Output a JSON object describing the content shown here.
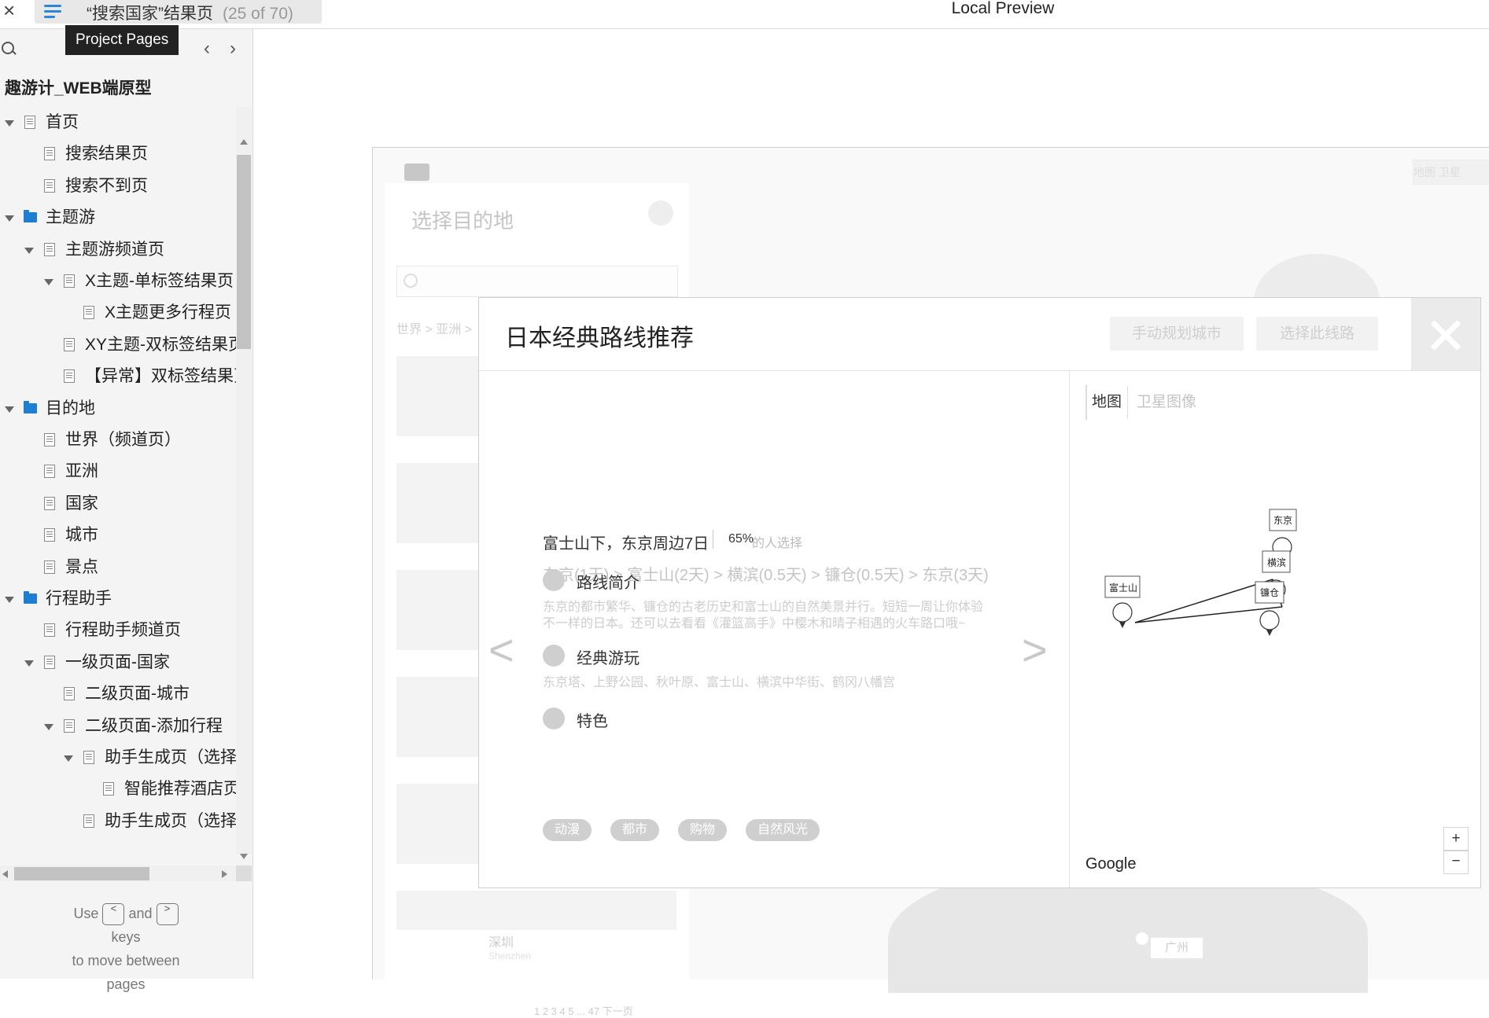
{
  "topbar": {
    "close_glyph": "×",
    "page_title": "“搜索国家”结果页",
    "page_count": "(25 of 70)",
    "preview_title": "Local Preview"
  },
  "sidebar": {
    "tooltip": "Project Pages",
    "project_name": "趣游计_WEB端原型",
    "prev_glyph": "‹",
    "next_glyph": "›",
    "items": [
      {
        "label": "首页",
        "icon": "page-icon"
      },
      {
        "label": "搜索结果页",
        "icon": "page-icon"
      },
      {
        "label": "搜索不到页",
        "icon": "page-icon"
      },
      {
        "label": "主题游",
        "icon": "folder-icon"
      },
      {
        "label": "主题游频道页",
        "icon": "page-icon"
      },
      {
        "label": "X主题-单标签结果页",
        "icon": "page-icon"
      },
      {
        "label": "X主题更多行程页",
        "icon": "page-icon"
      },
      {
        "label": "XY主题-双标签结果页",
        "icon": "page-icon"
      },
      {
        "label": "【异常】双标签结果页",
        "icon": "page-icon"
      },
      {
        "label": "目的地",
        "icon": "folder-icon"
      },
      {
        "label": "世界（频道页）",
        "icon": "page-icon"
      },
      {
        "label": "亚洲",
        "icon": "page-icon"
      },
      {
        "label": "国家",
        "icon": "page-icon"
      },
      {
        "label": "城市",
        "icon": "page-icon"
      },
      {
        "label": "景点",
        "icon": "page-icon"
      },
      {
        "label": "行程助手",
        "icon": "folder-icon"
      },
      {
        "label": "行程助手频道页",
        "icon": "page-icon"
      },
      {
        "label": "一级页面-国家",
        "icon": "page-icon"
      },
      {
        "label": "二级页面-城市",
        "icon": "page-icon"
      },
      {
        "label": "二级页面-添加行程",
        "icon": "page-icon"
      },
      {
        "label": "助手生成页（选择",
        "icon": "page-icon"
      },
      {
        "label": "智能推荐酒店页",
        "icon": "page-icon"
      },
      {
        "label": "助手生成页（选择",
        "icon": "page-icon"
      }
    ],
    "hint": {
      "use": "Use",
      "and": "and",
      "prev_key": "<",
      "next_key": ">",
      "keys": "keys",
      "line2": "to move between",
      "line3": "pages"
    }
  },
  "background_page": {
    "destination_placeholder": "选择目的地",
    "breadcrumb": "世界 > 亚洲 >",
    "list_city": "深圳",
    "list_city_en": "Shenzhen",
    "pager": "1  2  3  4  5  ...  47   下一页",
    "map_type": "地图  卫星",
    "map_city_label": "广州"
  },
  "modal": {
    "title": "日本经典路线推荐",
    "custom_button": "手动规划城市",
    "select_button": "选择此线路",
    "route": {
      "name": "富士山下，东京周边7日",
      "percent": "65%",
      "percent_label": "的人选择",
      "path": "东京(1天) > 富士山(2天) > 横滨(0.5天) > 镰仓(0.5天) > 东京(3天)"
    },
    "sections": [
      {
        "title": "路线简介",
        "body": [
          "东京的都市繁华、镰仓的古老历史和富士山的自然美景并行。短短一周让你体验",
          "不一样的日本。还可以去看看《灌篮高手》中樱木和晴子相遇的火车路口哦~"
        ]
      },
      {
        "title": "经典游玩",
        "body": [
          "东京塔、上野公园、秋叶原、富士山、横滨中华街、鹤冈八幡宫"
        ]
      },
      {
        "title": "特色",
        "body": []
      }
    ],
    "tags": [
      "动漫",
      "都市",
      "购物",
      "自然风光"
    ],
    "arrow_prev": "<",
    "arrow_next": ">",
    "map": {
      "tab_map": "地图",
      "tab_satellite": "卫星图像",
      "google": "Google",
      "zoom_in": "+",
      "zoom_out": "−",
      "markers": [
        "东京",
        "横滨",
        "富士山",
        "镰仓"
      ]
    }
  }
}
